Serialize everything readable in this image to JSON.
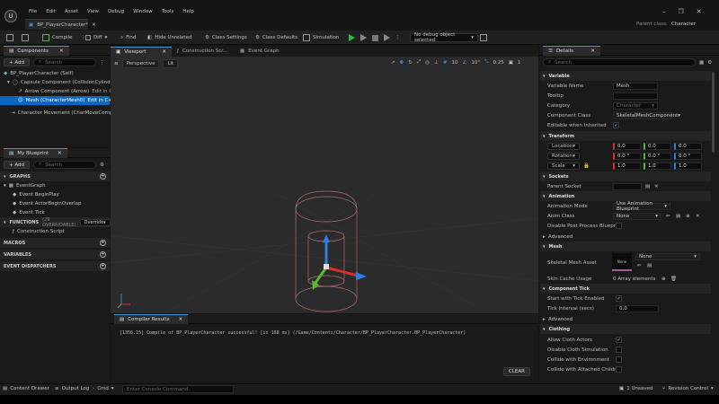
{
  "menu": [
    "File",
    "Edit",
    "Asset",
    "View",
    "Debug",
    "Window",
    "Tools",
    "Help"
  ],
  "logo_text": "U",
  "tab_title": "BP_PlayerCharacter*",
  "parent_class": {
    "label": "Parent class:",
    "value": "Character"
  },
  "window_controls": [
    "–",
    "❐",
    "✕"
  ],
  "toolbar": {
    "compile": "Compile",
    "diff": "Diff",
    "find": "Find",
    "hide_unrelated": "Hide Unrelated",
    "class_settings": "Class Settings",
    "class_defaults": "Class Defaults",
    "simulation": "Simulation",
    "debug_select": "No debug object selected"
  },
  "components": {
    "tab": "Components",
    "add": "+ Add",
    "search_placeholder": "Search",
    "items": [
      "BP_PlayerCharacter (Self)",
      "Capsule Component (CollisionCylinder)",
      "Arrow Component (Arrow)",
      "Mesh (CharacterMesh0)",
      "Character Movement (CharMoveComp)"
    ],
    "edit_cpp": "Edit in C++"
  },
  "my_blueprint": {
    "tab": "My Blueprint",
    "add": "+ Add",
    "search_placeholder": "Search",
    "graphs_header": "GRAPHS",
    "event_graph": "EventGraph",
    "events": [
      "Event BeginPlay",
      "Event ActorBeginOverlap",
      "Event Tick"
    ],
    "functions_header": "FUNCTIONS",
    "functions_count": "(29 OVERRIDABLE)",
    "override": "Override",
    "construction": "Construction Script",
    "macros": "MACROS",
    "variables": "VARIABLES",
    "dispatchers": "EVENT DISPATCHERS"
  },
  "editor_tabs": [
    "Viewport",
    "Construction Scr...",
    "Event Graph"
  ],
  "viewport": {
    "perspective": "Perspective",
    "lit": "Lit",
    "grid_snap": "10",
    "rot_snap": "10°",
    "scale_snap": "0.25",
    "cam_speed": "1"
  },
  "compiler": {
    "tab": "Compiler Results",
    "message": "[1356.15] Compile of BP_PlayerCharacter successful! [in 168 ms] (/Game/Contents/Character/BP_PlayerCharacter.BP_PlayerCharacter)",
    "clear": "CLEAR"
  },
  "details": {
    "tab": "Details",
    "search_placeholder": "Search",
    "variable": {
      "header": "Variable",
      "name_label": "Variable Name",
      "name_value": "Mesh",
      "tooltip_label": "Tooltip",
      "category_label": "Category",
      "category_value": "Character",
      "class_label": "Component Class",
      "class_value": "SkeletalMeshComponent",
      "editable_label": "Editable when Inherited"
    },
    "transform": {
      "header": "Transform",
      "location": "Location",
      "rotation": "Rotation",
      "scale": "Scale",
      "loc": [
        "0.0",
        "0.0",
        "0.0"
      ],
      "rot": [
        "0.0 °",
        "0.0 °",
        "0.0 °"
      ],
      "scl": [
        "1.0",
        "1.0",
        "1.0"
      ]
    },
    "sockets": {
      "header": "Sockets",
      "parent_label": "Parent Socket"
    },
    "animation": {
      "header": "Animation",
      "mode_label": "Animation Mode",
      "mode_value": "Use Animation Blueprint",
      "class_label": "Anim Class",
      "class_value": "None",
      "disable_pp": "Disable Post Process Blueprint"
    },
    "advanced": "Advanced",
    "mesh": {
      "header": "Mesh",
      "skeletal_label": "Skeletal Mesh Asset",
      "skeletal_value": "None",
      "thumb": "None",
      "skin_label": "Skin Cache Usage",
      "skin_value": "0 Array elements"
    },
    "tick": {
      "header": "Component Tick",
      "start_label": "Start with Tick Enabled",
      "interval_label": "Tick Interval (secs)",
      "interval_value": "0.0"
    },
    "advanced2": "Advanced",
    "clothing": {
      "header": "Clothing",
      "items": [
        "Allow Cloth Actors",
        "Disable Cloth Simulation",
        "Collide with Environment",
        "Collide with Attached Children"
      ],
      "checked": [
        true,
        false,
        false,
        false
      ]
    }
  },
  "status": {
    "content_drawer": "Content Drawer",
    "output_log": "Output Log",
    "cmd": "Cmd",
    "console_placeholder": "Enter Console Command",
    "unsaved": "1 Unsaved",
    "revision": "Revision Control"
  },
  "colors": {
    "accent": "#0b67c4",
    "play": "#37b34a",
    "x_axis": "#d9302c",
    "y_axis": "#5ab833",
    "z_axis": "#2f7fe0"
  }
}
